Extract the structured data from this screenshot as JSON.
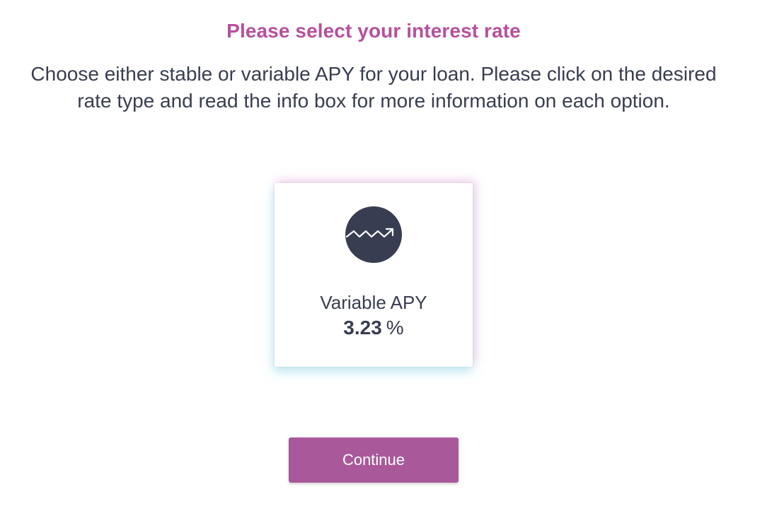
{
  "header": {
    "title": "Please select your interest rate",
    "description": "Choose either stable or variable APY for your loan. Please click on the desired rate type and read the info box for more information on each option."
  },
  "rate_option": {
    "icon": "trending-up-icon",
    "label": "Variable APY",
    "value": "3.23",
    "unit": "%"
  },
  "actions": {
    "continue_label": "Continue"
  },
  "colors": {
    "accent": "#b6509e",
    "button": "#a9599a",
    "text": "#383d51",
    "icon_bg": "#383d51"
  }
}
